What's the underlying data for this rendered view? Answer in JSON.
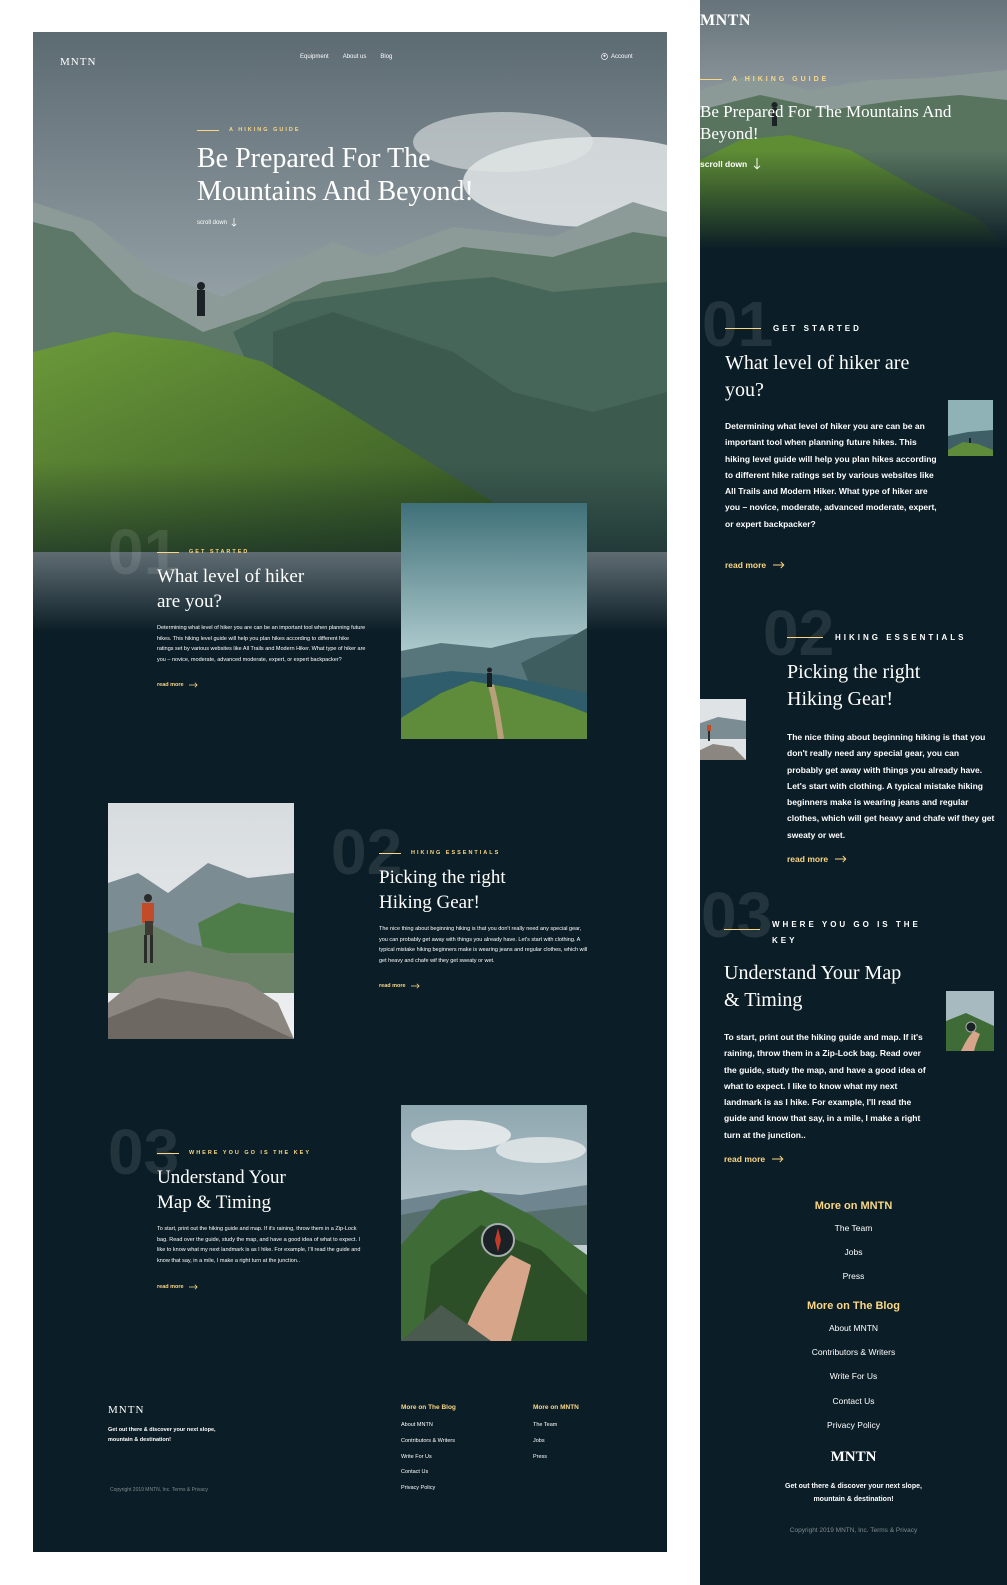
{
  "brand": "MNTN",
  "colors": {
    "background": "#0b1d26",
    "accent": "#fbd784",
    "text": "#ffffff"
  },
  "nav": {
    "items": [
      "Equipment",
      "About us",
      "Blog"
    ],
    "account": "Account",
    "account_icon": "user-circle-icon",
    "menu_icon": "hamburger-menu-icon"
  },
  "hero": {
    "eyebrow": "A HIKING GUIDE",
    "title_line1": "Be Prepared For The",
    "title_line2": "Mountains And Beyond!",
    "mobile_title_line1": "Be Prepared For The Mountains And",
    "mobile_title_line2": "Beyond!",
    "scroll": "scroll down",
    "scroll_icon": "arrow-down-icon"
  },
  "sections": [
    {
      "number": "01",
      "tag": "GET STARTED",
      "title_line1": "What level of hiker",
      "title_line2": "are you?",
      "mobile_title_line1": "What level of hiker are",
      "mobile_title_line2": "you?",
      "text": "Determining what level of hiker you are can be an important tool when planning future hikes. This hiking level guide will help you plan hikes according to different hike ratings set by various websites like All Trails and Modern Hiker. What type of hiker are you – novice, moderate, advanced moderate, expert, or expert backpacker?",
      "read_more": "read more",
      "image": "hiker-on-trail-photo"
    },
    {
      "number": "02",
      "tag": "HIKING ESSENTIALS",
      "title_line1": "Picking the right",
      "title_line2": "Hiking Gear!",
      "text": "The nice thing about beginning hiking is that you don't really need any special gear, you can probably get away with things you already have. Let's start with clothing. A typical mistake hiking beginners make is wearing jeans and regular clothes, which will get heavy and chafe wif they get sweaty or wet.",
      "read_more": "read more",
      "image": "hiker-on-rock-photo"
    },
    {
      "number": "03",
      "tag": "WHERE YOU GO IS THE KEY",
      "mobile_tag_line1": "WHERE YOU GO IS THE",
      "mobile_tag_line2": "KEY",
      "title_line1": "Understand Your",
      "title_line2": "Map & Timing",
      "mobile_title_line1": "Understand Your Map",
      "mobile_title_line2": "& Timing",
      "text": "To start, print out the hiking guide and map. If it's raining, throw them in a Zip-Lock bag. Read over the guide, study the map, and have a good idea of what to expect. I like to know what my next landmark is as I hike. For example, I'll read the guide and know that say, in a mile, I make a right turn at the junction..",
      "read_more": "read more",
      "image": "compass-in-hand-photo"
    }
  ],
  "footer": {
    "tagline": "Get out there & discover your next slope, mountain & destination!",
    "copyright": "Copyright 2019 MNTN, Inc. Terms & Privacy",
    "blog_title": "More on The Blog",
    "blog_links": [
      "About MNTN",
      "Contributors & Writers",
      "Write For Us",
      "Contact Us",
      "Privacy Policy"
    ],
    "mntn_title": "More on MNTN",
    "mntn_links": [
      "The Team",
      "Jobs",
      "Press"
    ]
  },
  "arrow_icon": "arrow-right-icon"
}
